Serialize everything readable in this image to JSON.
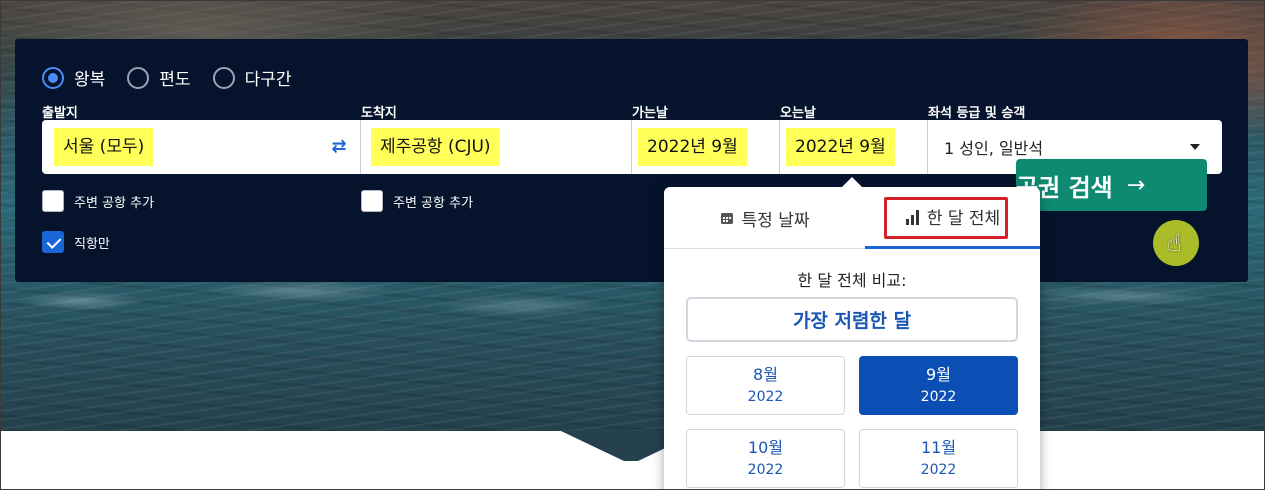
{
  "trip_types": [
    {
      "label": "왕복",
      "selected": true
    },
    {
      "label": "편도",
      "selected": false
    },
    {
      "label": "다구간",
      "selected": false
    }
  ],
  "labels": {
    "origin": "출발지",
    "destination": "도착지",
    "depart": "가는날",
    "return": "오는날",
    "cabin": "좌석 등급 및 승객"
  },
  "values": {
    "origin": "서울 (모두)",
    "destination": "제주공항 (CJU)",
    "depart": "2022년 9월",
    "return": "2022년 9월",
    "cabin": "1 성인, 일반석"
  },
  "checks": {
    "nearby_origin": {
      "label": "주변 공항 추가",
      "checked": false
    },
    "nearby_destination": {
      "label": "주변 공항 추가",
      "checked": false
    },
    "direct_only": {
      "label": "직항만",
      "checked": true
    }
  },
  "search_button": {
    "label": "항공권 검색",
    "arrow": "→"
  },
  "date_picker": {
    "tab_specific": "특정 날짜",
    "tab_whole_month": "한 달 전체",
    "active_tab": "whole_month",
    "compare_label": "한 달 전체 비교:",
    "cheapest_button": "가장 저렴한 달",
    "months": [
      {
        "month": "8월",
        "year": "2022",
        "selected": false
      },
      {
        "month": "9월",
        "year": "2022",
        "selected": true
      },
      {
        "month": "10월",
        "year": "2022",
        "selected": false
      },
      {
        "month": "11월",
        "year": "2022",
        "selected": false
      }
    ]
  },
  "colors": {
    "panel_bg": "#05132d",
    "accent_blue": "#1a66d9",
    "search_green": "#0e8a73",
    "highlight_yellow": "#ffff59",
    "annotation_red": "#d4202a"
  }
}
